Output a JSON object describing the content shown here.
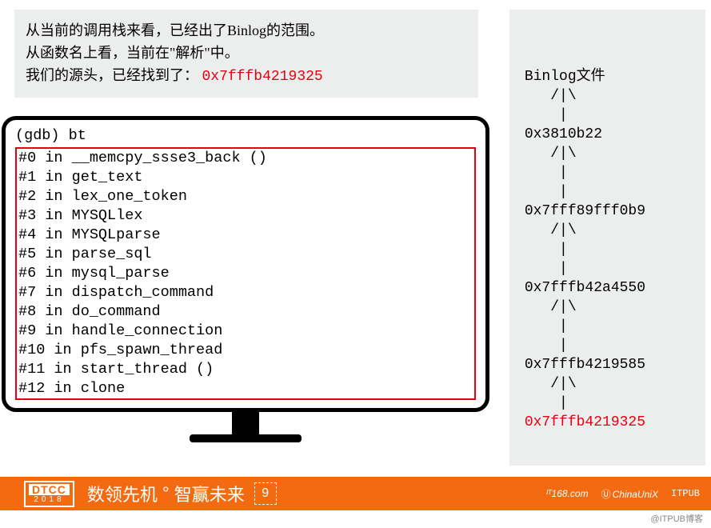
{
  "summary": {
    "line1": "从当前的调用栈来看，已经出了Binlog的范围。",
    "line2": "从函数名上看，当前在\"解析\"中。",
    "line3_prefix": "我们的源头，已经找到了：  ",
    "line3_addr": "0x7fffb4219325"
  },
  "gdb": {
    "prompt": "(gdb) bt",
    "frames": [
      "#0  in __memcpy_ssse3_back ()",
      "#1  in get_text",
      "#2  in lex_one_token",
      "#3  in MYSQLlex",
      "#4  in MYSQLparse",
      "#5  in parse_sql",
      "#6  in mysql_parse",
      "#7  in dispatch_command",
      "#8  in do_command",
      "#9  in handle_connection",
      "#10 in pfs_spawn_thread",
      "#11 in start_thread ()",
      "#12 in clone"
    ]
  },
  "tree": {
    "title_prefix": "Binlog",
    "title_suffix_cn": "文件",
    "branch": "/|\\",
    "pipe": "|",
    "nodes": [
      "0x3810b22",
      "0x7fff89fff0b9",
      "0x7fffb42a4550",
      "0x7fffb4219585"
    ],
    "final": "0x7fffb4219325"
  },
  "watermark": "DTCC2018",
  "footer": {
    "brand_top": "DTCC",
    "brand_bot": "2018",
    "slogan_a": "数领先机",
    "slogan_b": "智赢未来",
    "nine": "9",
    "sponsors": {
      "it168": "ᴵᵀ168.com",
      "chinaunix": "ChinaUniX",
      "itpub": "ITPUB"
    }
  },
  "attrib": "@ITPUB博客"
}
